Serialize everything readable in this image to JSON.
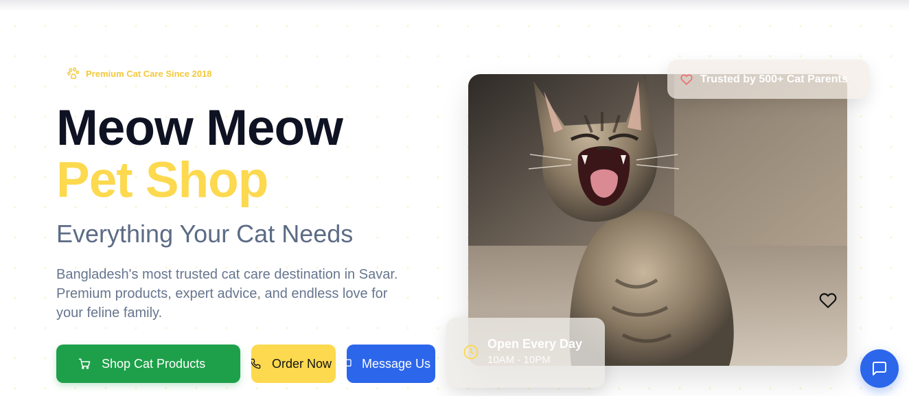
{
  "hero": {
    "tag": "Premium Cat Care Since 2018",
    "title_line1": "Meow Meow",
    "title_line2": "Pet Shop",
    "subtitle": "Everything Your Cat Needs",
    "description": "Bangladesh's most trusted cat care destination in Savar. Premium products, expert advice, and endless love for your feline family."
  },
  "buttons": {
    "shop": "Shop Cat Products",
    "order": "Order Now",
    "message": "Message Us"
  },
  "badges": {
    "trusted": "Trusted by 500+ Cat Parents",
    "open_title": "Open Every Day",
    "open_hours": "10AM - 10PM"
  },
  "colors": {
    "accent_yellow": "#fcd94e",
    "shop_green": "#1ea04a",
    "message_blue": "#2c66ea",
    "heading_dark": "#0e1222"
  },
  "icons": [
    "paw-icon",
    "cart-icon",
    "phone-icon",
    "message-icon",
    "heart-icon",
    "clock-icon",
    "chat-icon"
  ]
}
